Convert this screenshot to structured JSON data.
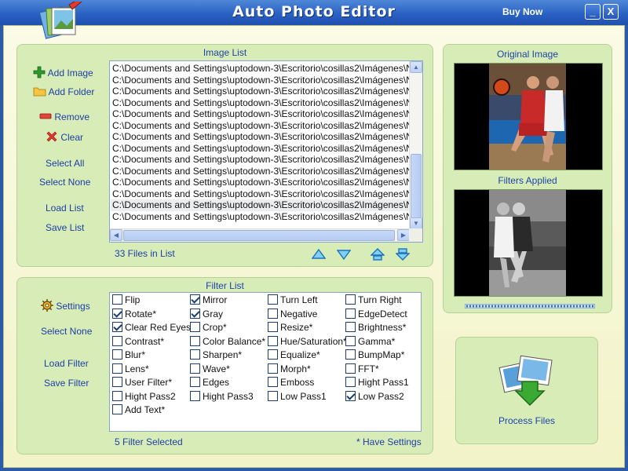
{
  "app": {
    "title": "Auto Photo Editor",
    "buy_now": "Buy Now",
    "minimize": "_",
    "close": "X"
  },
  "image_panel": {
    "title": "Image List",
    "actions": {
      "add_image": "Add Image",
      "add_folder": "Add Folder",
      "remove": "Remove",
      "clear": "Clear",
      "select_all": "Select All",
      "select_none": "Select None",
      "load_list": "Load List",
      "save_list": "Save List"
    },
    "files": [
      "C:\\Documents and Settings\\uptodown-3\\Escritorio\\cosillas2\\Imágenes\\Nu...",
      "C:\\Documents and Settings\\uptodown-3\\Escritorio\\cosillas2\\Imágenes\\Nu...",
      "C:\\Documents and Settings\\uptodown-3\\Escritorio\\cosillas2\\Imágenes\\Nu...",
      "C:\\Documents and Settings\\uptodown-3\\Escritorio\\cosillas2\\Imágenes\\Nu...",
      "C:\\Documents and Settings\\uptodown-3\\Escritorio\\cosillas2\\Imágenes\\Nu...",
      "C:\\Documents and Settings\\uptodown-3\\Escritorio\\cosillas2\\Imágenes\\Nu...",
      "C:\\Documents and Settings\\uptodown-3\\Escritorio\\cosillas2\\Imágenes\\Nu...",
      "C:\\Documents and Settings\\uptodown-3\\Escritorio\\cosillas2\\Imágenes\\Nu...",
      "C:\\Documents and Settings\\uptodown-3\\Escritorio\\cosillas2\\Imágenes\\Nu...",
      "C:\\Documents and Settings\\uptodown-3\\Escritorio\\cosillas2\\Imágenes\\Nu...",
      "C:\\Documents and Settings\\uptodown-3\\Escritorio\\cosillas2\\Imágenes\\Nu...",
      "C:\\Documents and Settings\\uptodown-3\\Escritorio\\cosillas2\\Imágenes\\Nu...",
      "C:\\Documents and Settings\\uptodown-3\\Escritorio\\cosillas2\\Imágenes\\Nu...",
      "C:\\Documents and Settings\\uptodown-3\\Escritorio\\cosillas2\\Imágenes\\Nu..."
    ],
    "selected_index": 12,
    "file_count": "33 Files in List"
  },
  "filter_panel": {
    "title": "Filter List",
    "actions": {
      "settings": "Settings",
      "select_none": "Select None",
      "load_filter": "Load Filter",
      "save_filter": "Save Filter"
    },
    "filters": [
      {
        "label": "Flip",
        "checked": false
      },
      {
        "label": "Mirror",
        "checked": true
      },
      {
        "label": "Turn Left",
        "checked": false
      },
      {
        "label": "Turn Right",
        "checked": false
      },
      {
        "label": "Rotate*",
        "checked": true
      },
      {
        "label": "Gray",
        "checked": true
      },
      {
        "label": "Negative",
        "checked": false
      },
      {
        "label": "EdgeDetect",
        "checked": false
      },
      {
        "label": "Clear Red Eyes",
        "checked": true
      },
      {
        "label": "Crop*",
        "checked": false
      },
      {
        "label": "Resize*",
        "checked": false
      },
      {
        "label": "Brightness*",
        "checked": false
      },
      {
        "label": "Contrast*",
        "checked": false
      },
      {
        "label": "Color Balance*",
        "checked": false
      },
      {
        "label": "Hue/Saturation*",
        "checked": false
      },
      {
        "label": "Gamma*",
        "checked": false
      },
      {
        "label": "Blur*",
        "checked": false
      },
      {
        "label": "Sharpen*",
        "checked": false
      },
      {
        "label": "Equalize*",
        "checked": false
      },
      {
        "label": "BumpMap*",
        "checked": false
      },
      {
        "label": "Lens*",
        "checked": false
      },
      {
        "label": "Wave*",
        "checked": false
      },
      {
        "label": "Morph*",
        "checked": false
      },
      {
        "label": "FFT*",
        "checked": false
      },
      {
        "label": "User Filter*",
        "checked": false
      },
      {
        "label": "Edges",
        "checked": false
      },
      {
        "label": "Emboss",
        "checked": false
      },
      {
        "label": "Hight Pass1",
        "checked": false
      },
      {
        "label": "Hight Pass2",
        "checked": false
      },
      {
        "label": "Hight Pass3",
        "checked": false
      },
      {
        "label": "Low Pass1",
        "checked": false
      },
      {
        "label": "Low Pass2",
        "checked": true
      },
      {
        "label": "Add Text*",
        "checked": false
      }
    ],
    "selected_count": "5 Filter Selected",
    "note": "* Have Settings"
  },
  "preview": {
    "original_title": "Original Image",
    "filtered_title": "Filters Applied"
  },
  "process": {
    "label": "Process Files"
  },
  "icons": {
    "add_image": "plus-icon",
    "add_folder": "folder-icon",
    "remove": "minus-icon",
    "clear": "x-icon",
    "settings": "gear-icon",
    "process": "photos-arrow-icon"
  },
  "colors": {
    "titlebar": "#2a62c4",
    "panel": "#d8ecb8",
    "link": "#1d3fa6",
    "arrow_buttons": "#2e8fd8"
  }
}
